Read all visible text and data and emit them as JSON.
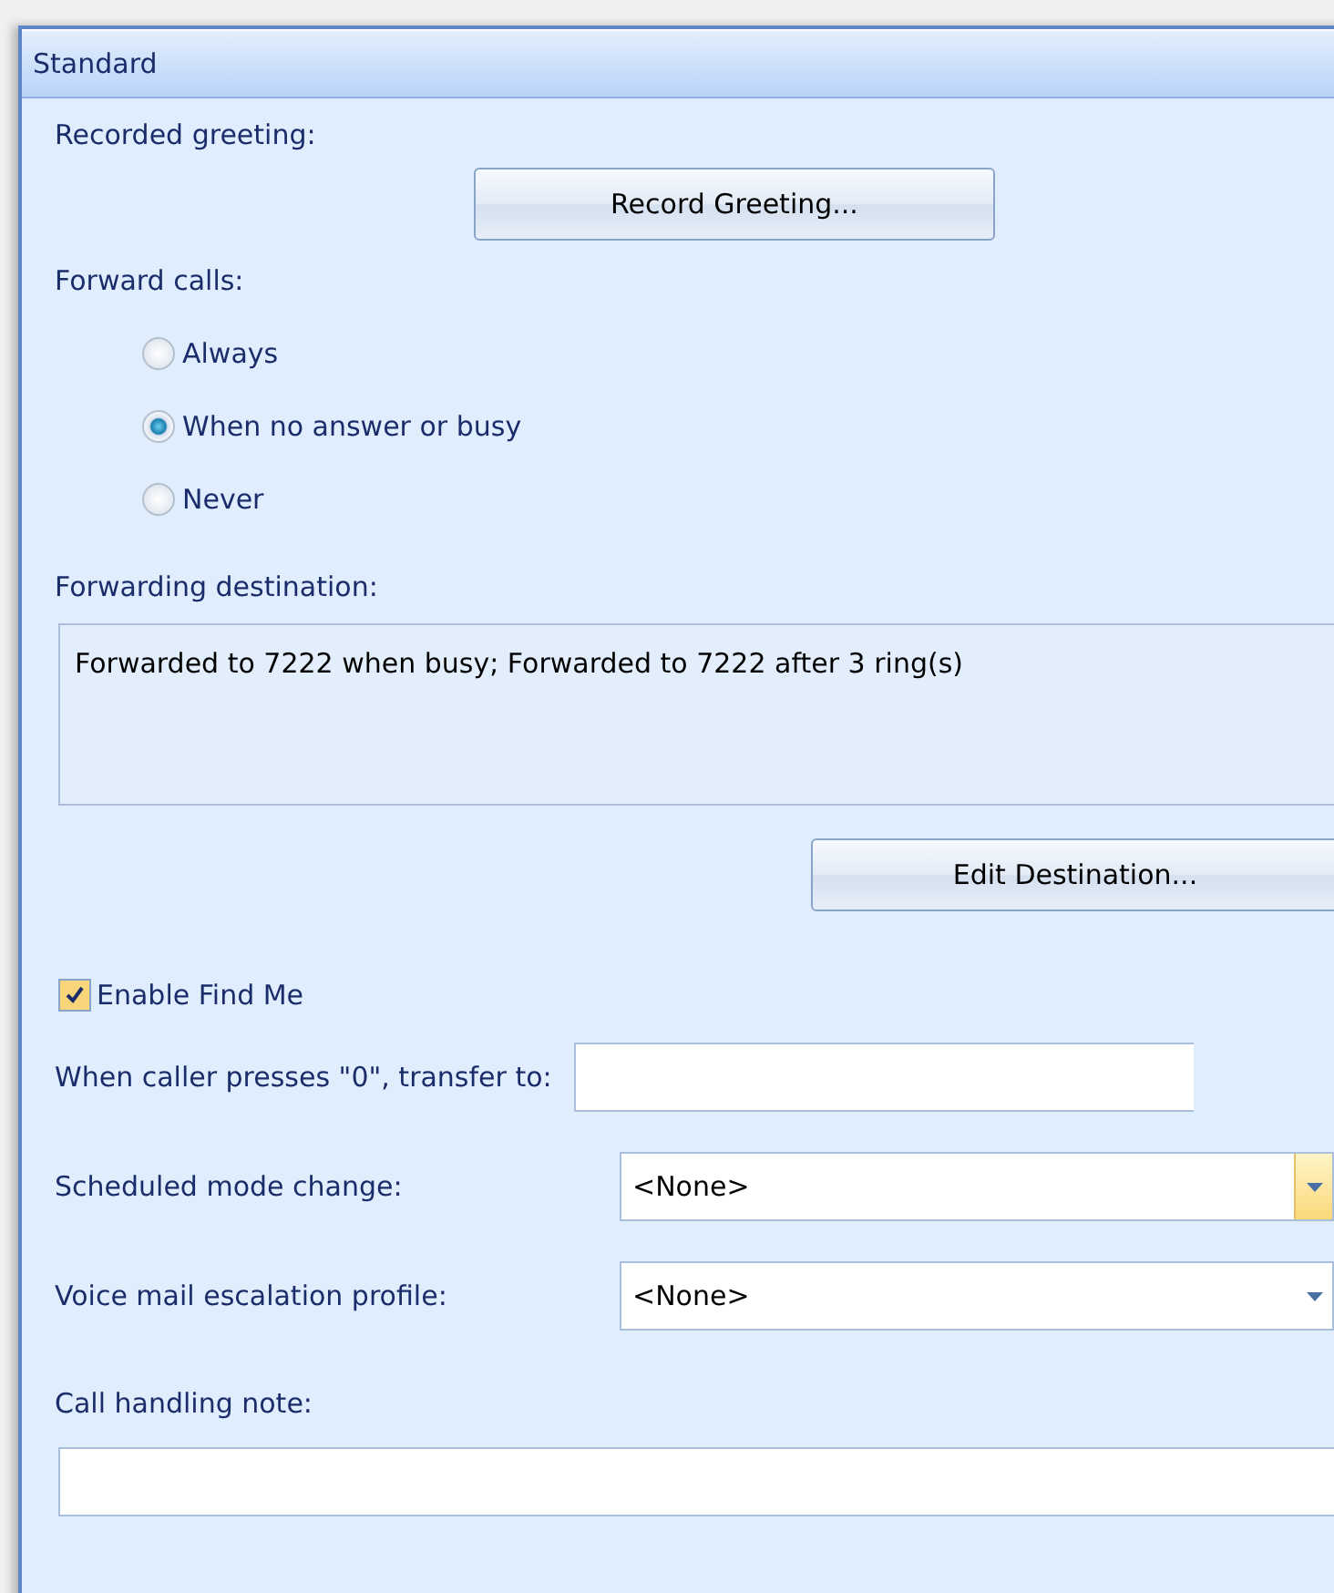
{
  "panel": {
    "title": "Standard"
  },
  "greeting": {
    "label": "Recorded greeting:",
    "button": "Record Greeting..."
  },
  "forward": {
    "label": "Forward calls:",
    "options": [
      {
        "label": "Always",
        "selected": false
      },
      {
        "label": "When no answer or busy",
        "selected": true
      },
      {
        "label": "Never",
        "selected": false
      }
    ]
  },
  "destination": {
    "label": "Forwarding destination:",
    "value": "Forwarded to 7222 when busy; Forwarded to 7222 after 3 ring(s)",
    "button": "Edit Destination..."
  },
  "find_me": {
    "label": "Enable Find Me",
    "checked": true
  },
  "transfer": {
    "label": "When caller presses \"0\", transfer to:"
  },
  "dropdowns": [
    {
      "label": "Scheduled mode change:",
      "value": "<None>",
      "highlighted": true
    },
    {
      "label": "Voice mail escalation profile:",
      "value": "<None>",
      "highlighted": false
    }
  ],
  "note": {
    "label": "Call handling note:"
  }
}
